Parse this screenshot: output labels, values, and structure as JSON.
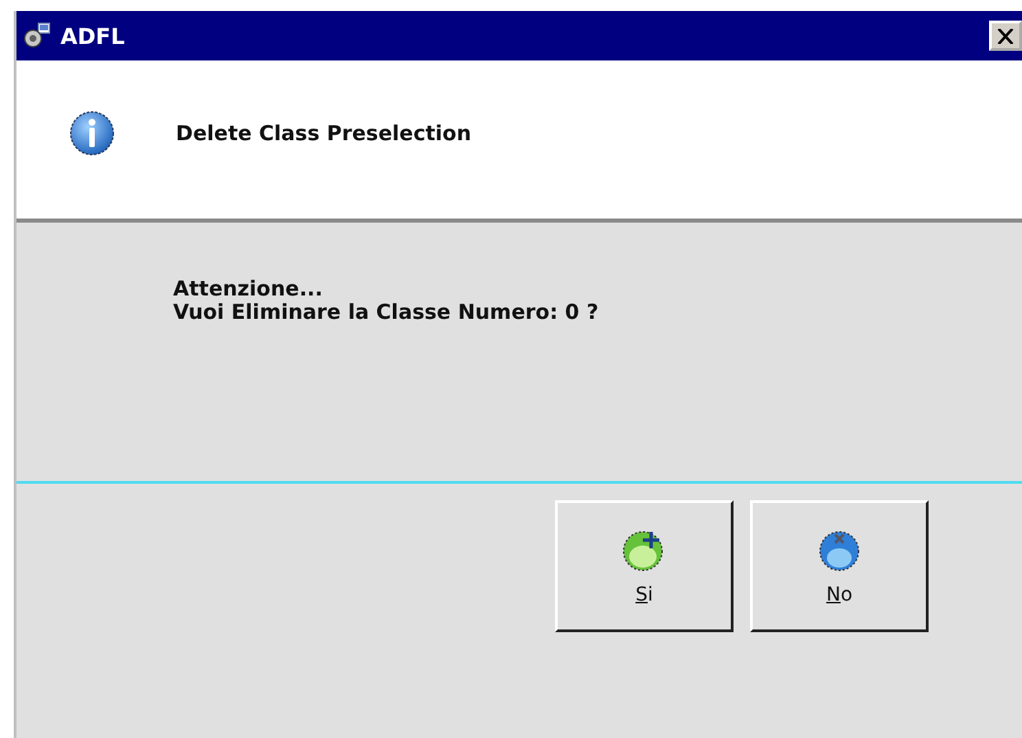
{
  "window": {
    "title": "ADFL"
  },
  "header": {
    "title": "Delete Class Preselection"
  },
  "message": [
    "Attenzione...",
    "Vuoi Eliminare la Classe Numero: 0 ?"
  ],
  "buttons": [
    {
      "label": "Si",
      "kind": "yes"
    },
    {
      "label": "No",
      "kind": "no"
    }
  ]
}
